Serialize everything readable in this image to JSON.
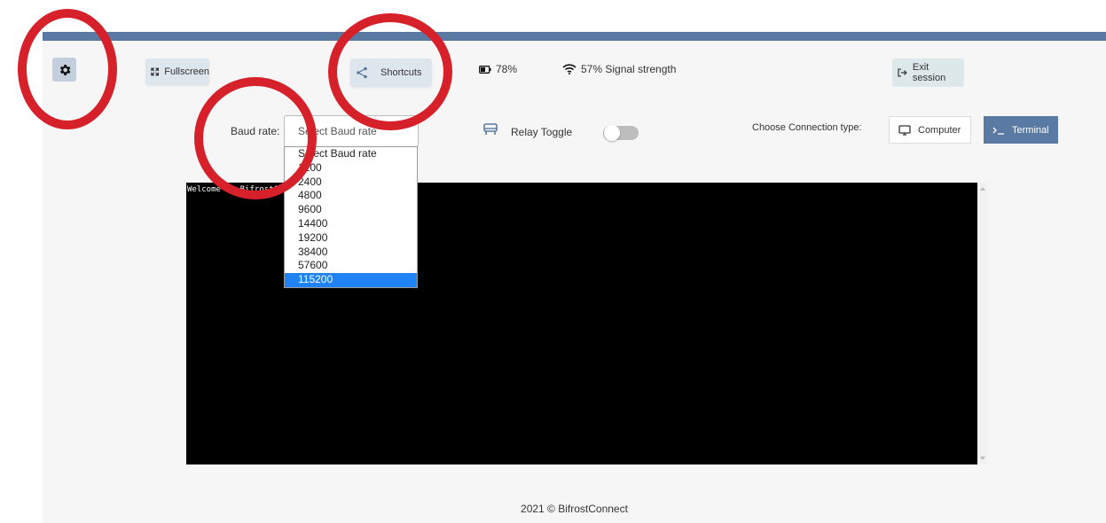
{
  "toolbar": {
    "fullscreen_label": "Fullscreen",
    "shortcuts_label": "Shortcuts",
    "battery": "78%",
    "signal": "57% Signal strength",
    "exit_label": "Exit session"
  },
  "baud": {
    "label": "Baud rate:",
    "placeholder": "Select Baud rate",
    "options": [
      "Select Baud rate",
      "1200",
      "2400",
      "4800",
      "9600",
      "14400",
      "19200",
      "38400",
      "57600",
      "115200"
    ],
    "highlighted": "115200"
  },
  "relay": {
    "label": "Relay Toggle",
    "on": false
  },
  "connection": {
    "label": "Choose Connection type:",
    "computer_label": "Computer",
    "terminal_label": "Terminal",
    "active": "Terminal"
  },
  "terminal": {
    "text": "Welcome to BifrostConnect Terminal"
  },
  "footer": "2021 © BifrostConnect",
  "colors": {
    "accent": "#5b7aa3",
    "annotation": "#d6202a",
    "selected_option": "#1f83f4"
  }
}
